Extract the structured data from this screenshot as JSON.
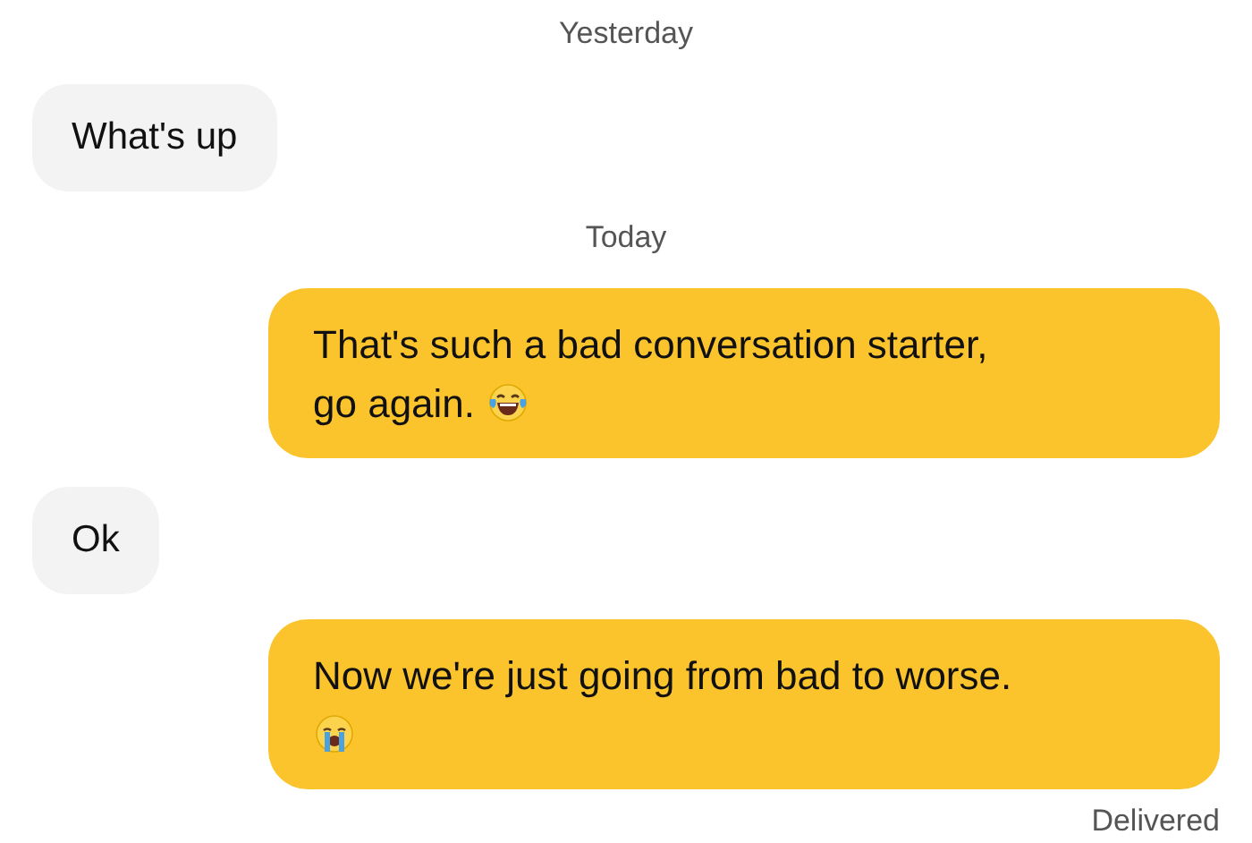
{
  "messages": [
    {
      "kind": "date",
      "text": "Yesterday"
    },
    {
      "kind": "incoming",
      "text": "What's up"
    },
    {
      "kind": "date",
      "text": "Today"
    },
    {
      "kind": "outgoing",
      "text": "That's such a bad conversation starter, go again.",
      "emoji": {
        "kind": "laugh"
      }
    },
    {
      "kind": "incoming",
      "text": "Ok"
    },
    {
      "kind": "outgoing",
      "text": "Now we're just going from bad to worse.",
      "emoji": {
        "kind": "cry"
      }
    }
  ],
  "status": "Delivered"
}
